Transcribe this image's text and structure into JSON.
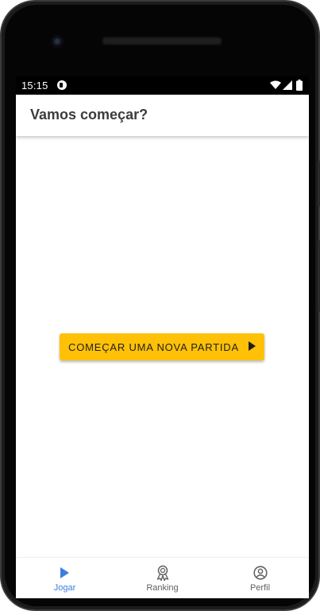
{
  "status_bar": {
    "time": "15:15",
    "icons": [
      "app-notification-icon",
      "wifi-icon",
      "signal-icon",
      "battery-icon"
    ]
  },
  "app_bar": {
    "title": "Vamos começar?"
  },
  "main": {
    "start_button_label": "COMEÇAR UMA NOVA PARTIDA",
    "start_button_icon": "play-arrow-icon"
  },
  "bottom_nav": {
    "items": [
      {
        "label": "Jogar",
        "icon": "play-arrow-icon",
        "active": true
      },
      {
        "label": "Ranking",
        "icon": "award-ribbon-icon",
        "active": false
      },
      {
        "label": "Perfil",
        "icon": "account-circle-icon",
        "active": false
      }
    ]
  },
  "colors": {
    "accent_button": "#ffc107",
    "active_nav": "#3d7de0",
    "inactive_nav": "#616161",
    "title_text": "#3c3c3c"
  }
}
